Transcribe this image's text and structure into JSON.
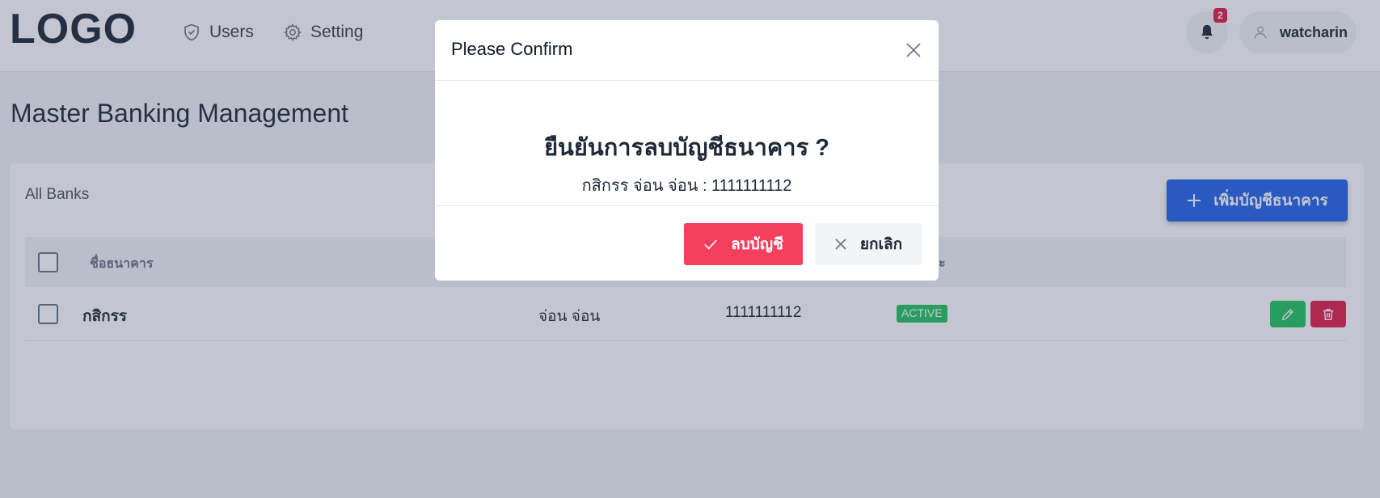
{
  "header": {
    "logo": "LOGO",
    "nav": [
      {
        "label": "Users",
        "icon": "shield-icon"
      },
      {
        "label": "Setting",
        "icon": "gear-icon"
      }
    ],
    "notifications": {
      "count": "2",
      "icon": "bell-icon"
    },
    "user": {
      "name": "watcharin",
      "icon": "user-icon"
    }
  },
  "page": {
    "title": "Master Banking Management"
  },
  "card": {
    "title": "All Banks",
    "add_button_label": "เพิ่มบัญชีธนาคาร",
    "table": {
      "columns": {
        "name": "ชื่อธนาคาร",
        "status": "ะ"
      },
      "rows": [
        {
          "bank": "กสิกรร",
          "holder": "จ่อน จ่อน",
          "number": "1111111112",
          "status": "ACTIVE"
        }
      ]
    }
  },
  "modal": {
    "title": "Please Confirm",
    "question": "ยืนยันการลบบัญชีธนาคาร ?",
    "detail": "กสิกรร จ่อน จ่อน : 1111111112",
    "confirm_label": "ลบบัญชี",
    "cancel_label": "ยกเลิก"
  },
  "colors": {
    "primary": "#2563eb",
    "danger": "#f43f5e",
    "success": "#22c55e",
    "overlay": "rgba(55, 65, 100, 0.30)"
  }
}
